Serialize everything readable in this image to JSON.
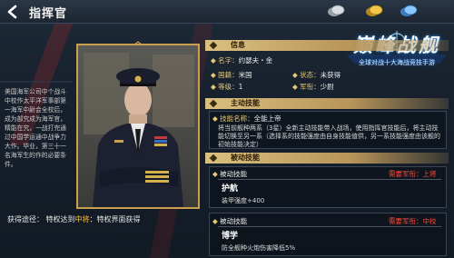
{
  "header": {
    "title": "指挥官"
  },
  "logo": {
    "title": "巅峰战舰",
    "subtitle": "全球对战十大海战竞技手游"
  },
  "commander": {
    "bio": "美国海军公司中个战斗中校作太平洋军事部第一海军中尉会全校后，成为部究成为海军官，精能在究，一战打完通过中国学运通中战争力大作。毕业，第三十一名海军生的作的必要条件。",
    "obtain_label": "获得途径：",
    "obtain_text_pre": "特权达到",
    "obtain_highlight": "中将",
    "obtain_text_post": "：特权界面获得"
  },
  "info": {
    "section_label": "信息",
    "name_label": "名字：",
    "name_value": "约瑟夫・金",
    "country_label": "国籍：",
    "country_value": "米国",
    "status_label": "状态：",
    "status_value": "未获得",
    "level_label": "等级：",
    "level_value": "1",
    "rank_label": "军衔：",
    "rank_value": "少尉"
  },
  "active_skill": {
    "section_label": "主动技能",
    "name_label": "技能名称：",
    "name_value": "全能上帝",
    "desc": "将当前舰种两系（3星）全新主动技能带入战场，使用指挥官技能后，将主动技能切换至另一系（选择系的技能强度由自身技能值供，另一系技能强度由该舰的初始技能决定）"
  },
  "passive": {
    "section_label": "被动技能",
    "skill1_label": "被动技能",
    "skill1_rank": "需要军衔：上将",
    "skill1_name": "护航",
    "skill1_effect": "装甲强度+400",
    "skill2_label": "被动技能",
    "skill2_rank": "需要军衔：中校",
    "skill2_name": "博学",
    "skill2_effect": "防全舰种火炮伤害降低5%"
  },
  "colors": {
    "gold": "#e5c877",
    "rank_red": "#ff4a3a",
    "highlight": "#ffc640"
  }
}
